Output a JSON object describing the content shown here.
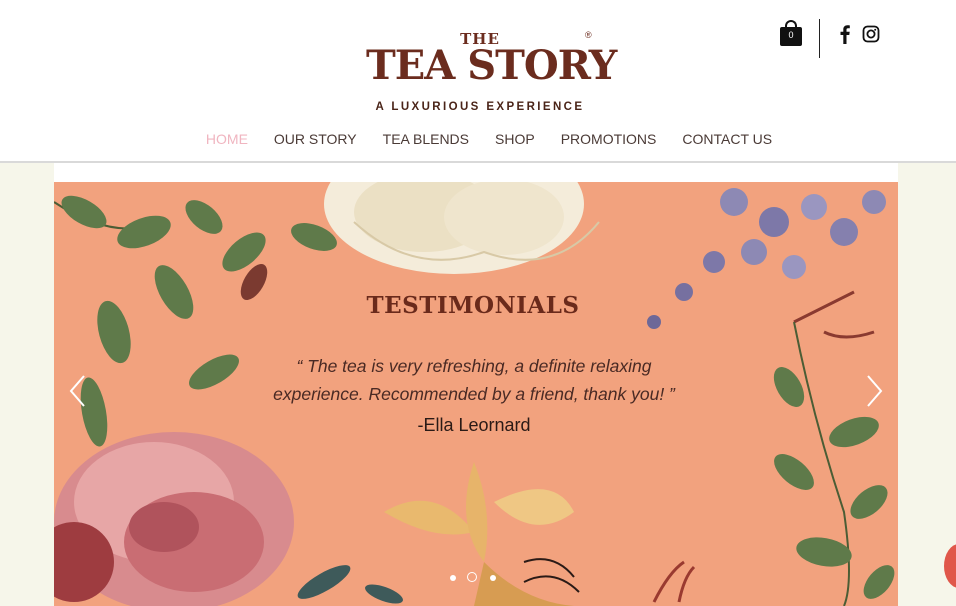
{
  "brand": {
    "the": "THE",
    "name": "TEA STORY",
    "registered": "®",
    "tagline": "A LUXURIOUS EXPERIENCE"
  },
  "cart": {
    "count": "0"
  },
  "social": [
    {
      "icon": "facebook-icon"
    },
    {
      "icon": "instagram-icon"
    }
  ],
  "nav": [
    {
      "label": "HOME",
      "active": true
    },
    {
      "label": "OUR STORY"
    },
    {
      "label": "TEA BLENDS"
    },
    {
      "label": "SHOP"
    },
    {
      "label": "PROMOTIONS"
    },
    {
      "label": "CONTACT US"
    }
  ],
  "slideshow": {
    "title": "TESTIMONIALS",
    "quote": "“ The tea is very refreshing, a definite relaxing experience. Recommended by a friend, thank you! ”",
    "author": "-Ella Leornard",
    "slide_count": 3,
    "active_slide": 2
  },
  "colors": {
    "accent_active_nav": "#f0b5c0",
    "brand_brown": "#6b2c1e",
    "slide_background": "#f2a27e",
    "page_background": "#f6f6ea"
  }
}
